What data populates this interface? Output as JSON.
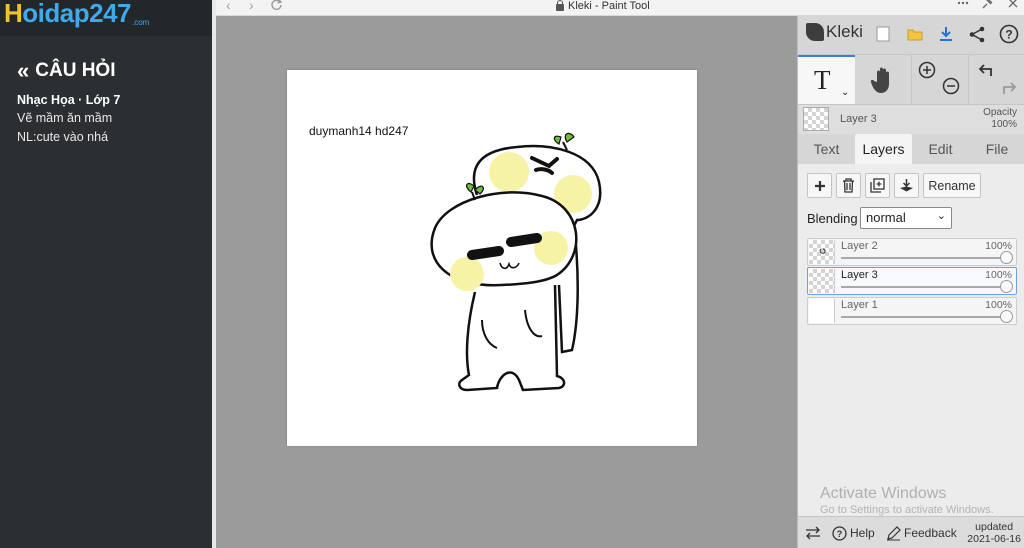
{
  "site": {
    "brand_letter": "H",
    "brand_rest": "oidap247",
    "brand_suffix": ".com"
  },
  "sidebar": {
    "back_label": "CÂU HỎI",
    "subject": "Nhạc Họa · Lớp 7",
    "line1": "Vẽ mầm ăn mầm",
    "line2": "NL:cute vào nhá"
  },
  "browser": {
    "title": "Kleki - Paint Tool",
    "back_glyph": "‹",
    "forward_glyph": "›"
  },
  "canvas": {
    "text": "duymanh14 hd247"
  },
  "panel": {
    "logo": "Kleki",
    "current_layer": "Layer 3",
    "opacity_label": "Opacity",
    "opacity_value": "100%",
    "tabs": [
      "Text",
      "Layers",
      "Edit",
      "File"
    ],
    "active_tab": "Layers",
    "rename_label": "Rename",
    "blending_label": "Blending",
    "blending_value": "normal",
    "layers": [
      {
        "name": "Layer 2",
        "opacity": "100%",
        "selected": false
      },
      {
        "name": "Layer 3",
        "opacity": "100%",
        "selected": true
      },
      {
        "name": "Layer 1",
        "opacity": "100%",
        "selected": false
      }
    ],
    "activate_title": "Activate Windows",
    "activate_sub": "Go to Settings to activate Windows.",
    "footer": {
      "help": "Help",
      "feedback": "Feedback",
      "updated_label": "updated",
      "updated_date": "2021-06-16"
    }
  },
  "colors": {
    "accent": "#3c7fd8",
    "sidebar_bg": "#2b2f31",
    "brand_blue": "#3fa9ea",
    "brand_yellow": "#f2c12e",
    "cheek_yellow": "#f7f3a6"
  }
}
